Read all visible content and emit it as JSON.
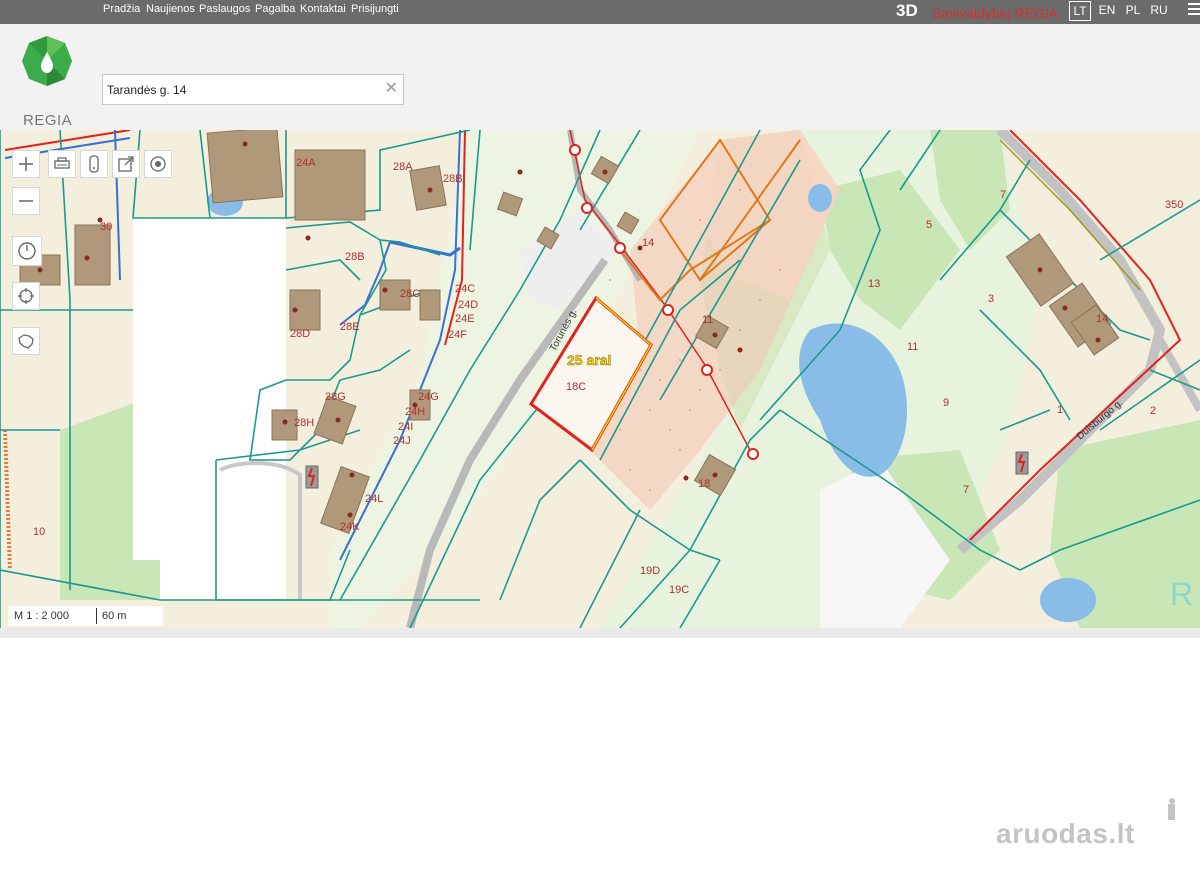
{
  "top_nav": {
    "links": [
      "Pradžia",
      "Naujienos",
      "Paslaugos",
      "Pagalba",
      "Kontaktai",
      "Prisijungti"
    ],
    "three_d_label": "3D",
    "brand": "Savivaldybių REGIA",
    "languages": [
      "LT",
      "EN",
      "PL",
      "RU"
    ],
    "active_language": "LT"
  },
  "logo": {
    "text": "REGIA"
  },
  "search": {
    "value": "Tarandės g. 14"
  },
  "map": {
    "plot_labels": [
      "24A",
      "28A",
      "28B",
      "30",
      "28B",
      "28C",
      "28D",
      "28E",
      "24C",
      "24D",
      "24E",
      "24F",
      "28G",
      "24G",
      "24H",
      "24I",
      "24J",
      "28H",
      "24L",
      "24K",
      "10",
      "14",
      "18C",
      "18",
      "19D",
      "19C",
      "5",
      "13",
      "11",
      "9",
      "3",
      "1",
      "2",
      "7",
      "7",
      "350",
      "14",
      "11"
    ],
    "street_labels": [
      "Torunės g.",
      "Duisburgo g."
    ],
    "highlight_label": "25 arai",
    "colors": {
      "parcel_line": "#1a9a8f",
      "highlight_border": "#e0231c",
      "highlight_text": "#f5d000",
      "plot_number": "#b03030",
      "building": "#b0987a",
      "water": "#89bde8",
      "land": "#f3ecdc",
      "green": "#c9e6b7"
    }
  },
  "scale": {
    "label": "M 1 : 2 000",
    "length": "60 m"
  },
  "watermark": {
    "text": "aruodas.lt"
  }
}
